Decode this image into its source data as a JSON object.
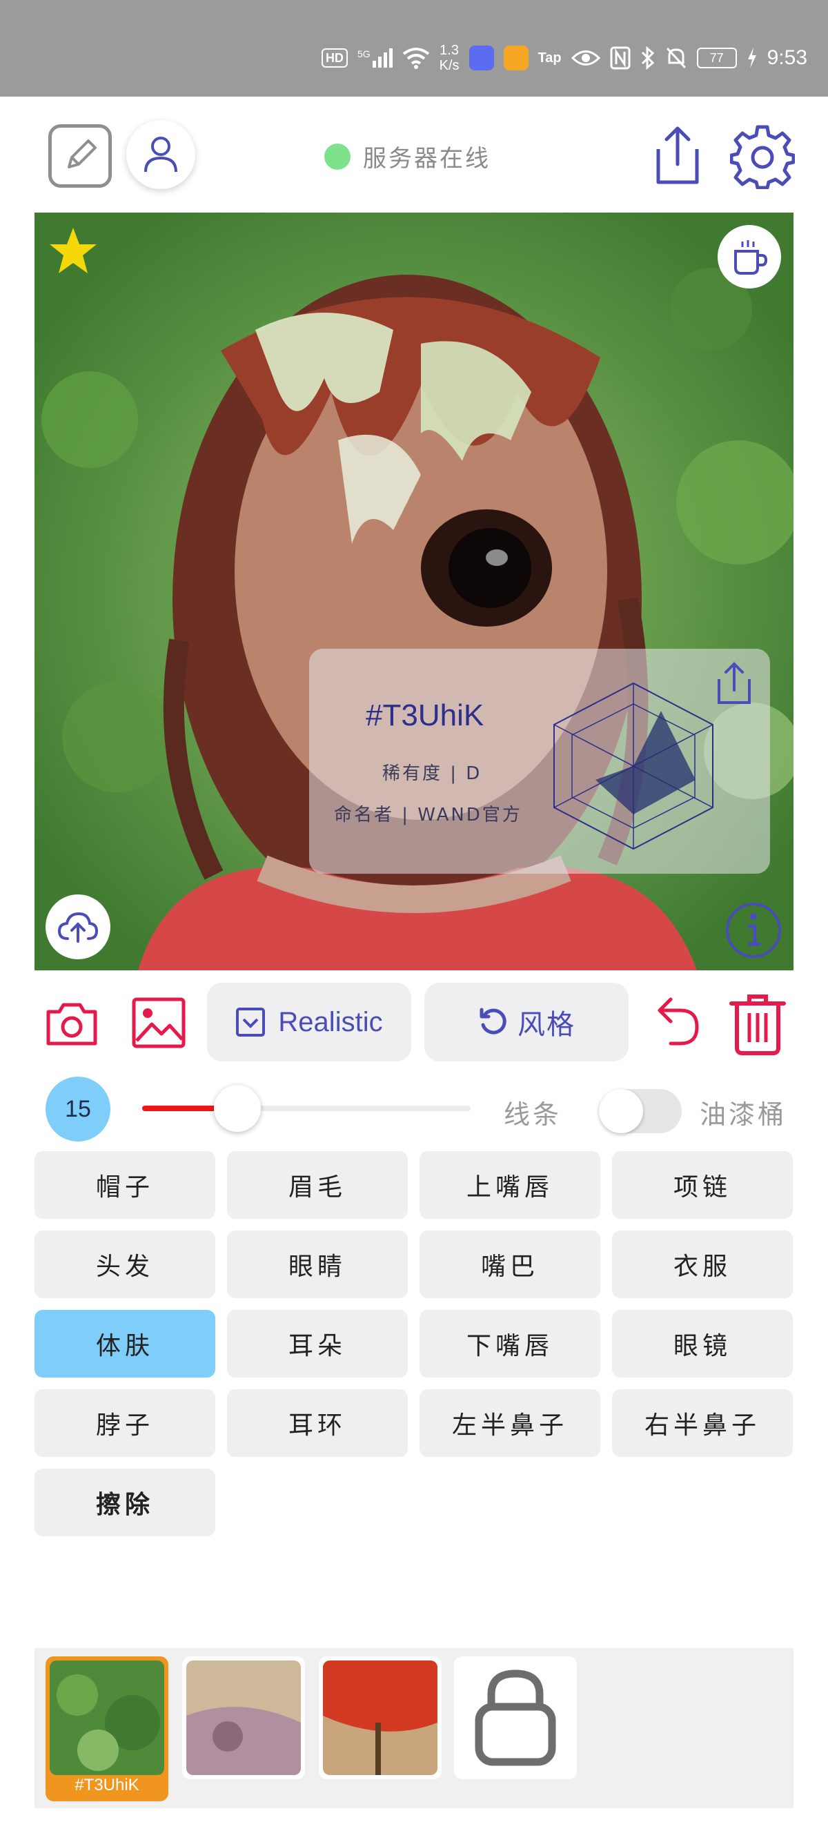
{
  "status_bar": {
    "hd_badge": "HD",
    "network": "5G",
    "speed_value": "1.3",
    "speed_unit": "K/s",
    "tap_label": "Tap",
    "battery": "77",
    "time": "9:53"
  },
  "header": {
    "server_status": "服务器在线",
    "server_status_color": "#7ee28c"
  },
  "card": {
    "code": "#T3UhiK",
    "rarity": "稀有度 | D",
    "namer": "命名者 | WAND官方"
  },
  "toolbar": {
    "model_label": "Realistic",
    "style_label": "风格"
  },
  "brush": {
    "size": "15",
    "slider_fraction": 0.29,
    "line_label": "线条",
    "bucket_label": "油漆桶",
    "bucket_enabled": false,
    "accent_color": "#f01414"
  },
  "parts": [
    {
      "label": "帽子",
      "active": false
    },
    {
      "label": "眉毛",
      "active": false
    },
    {
      "label": "上嘴唇",
      "active": false
    },
    {
      "label": "项链",
      "active": false
    },
    {
      "label": "头发",
      "active": false
    },
    {
      "label": "眼睛",
      "active": false
    },
    {
      "label": "嘴巴",
      "active": false
    },
    {
      "label": "衣服",
      "active": false
    },
    {
      "label": "体肤",
      "active": true
    },
    {
      "label": "耳朵",
      "active": false
    },
    {
      "label": "下嘴唇",
      "active": false
    },
    {
      "label": "眼镜",
      "active": false
    },
    {
      "label": "脖子",
      "active": false
    },
    {
      "label": "耳环",
      "active": false
    },
    {
      "label": "左半鼻子",
      "active": false
    },
    {
      "label": "右半鼻子",
      "active": false
    },
    {
      "label": "擦除",
      "active": false,
      "erase": true
    }
  ],
  "gallery": {
    "selected_label": "#T3UhiK",
    "selected_color": "#f0951e"
  },
  "colors": {
    "primary_icon": "#4a4db8",
    "danger_icon": "#e6194b",
    "active_part": "#7fcdf9"
  }
}
